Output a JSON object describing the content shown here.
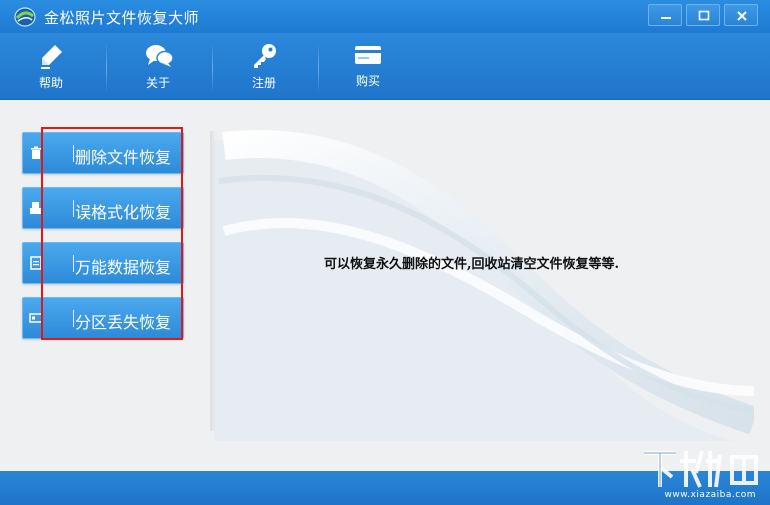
{
  "window": {
    "title": "金松照片文件恢复大师",
    "minimize_icon": "minimize-icon",
    "maximize_icon": "maximize-icon",
    "close_icon": "close-icon"
  },
  "toolbar": {
    "items": [
      {
        "label": "帮助",
        "icon": "pen-icon"
      },
      {
        "label": "关于",
        "icon": "chat-bubbles-icon"
      },
      {
        "label": "注册",
        "icon": "key-icon"
      },
      {
        "label": "购买",
        "icon": "credit-card-icon"
      }
    ]
  },
  "nav": {
    "items": [
      {
        "label": "删除文件恢复",
        "icon": "trash-icon"
      },
      {
        "label": "误格式化恢复",
        "icon": "drive-icon"
      },
      {
        "label": "万能数据恢复",
        "icon": "document-icon"
      },
      {
        "label": "分区丢失恢复",
        "icon": "partition-icon"
      }
    ]
  },
  "main": {
    "description": "可以恢复永久删除的文件,回收站清空文件恢复等等."
  },
  "watermark": {
    "text": "www.xiazaiba.com"
  },
  "colors": {
    "titlebar": "#1e7ad2",
    "nav_button": "#2d8ad9",
    "highlight": "#e01818",
    "content_bg": "#eef0f2"
  }
}
